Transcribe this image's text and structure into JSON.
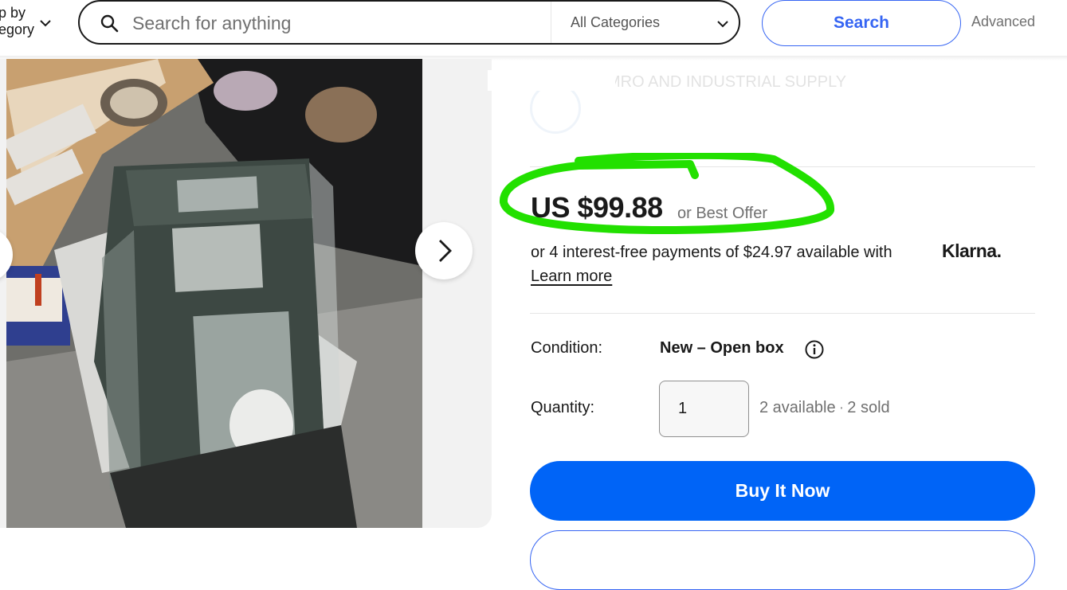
{
  "header": {
    "shop_by_line1": "p by",
    "shop_by_line2": "egory",
    "search_placeholder": "Search for anything",
    "category": "All Categories",
    "search_button": "Search",
    "advanced_link": "Advanced"
  },
  "seller": {
    "name": "MRO AND INDUSTRIAL SUPPLY",
    "line1": "",
    "line2": ""
  },
  "listing": {
    "price": "US $99.88",
    "best_offer": "or Best Offer",
    "installments": "or 4 interest-free payments of $24.97 available with",
    "klarna": "Klarna.",
    "learn_more": "Learn more",
    "condition_label": "Condition:",
    "condition_value": "New – Open box",
    "quantity_label": "Quantity:",
    "quantity_value": "1",
    "available": "2 available",
    "sold": "2 sold",
    "buy_now": "Buy It Now"
  },
  "colors": {
    "accent": "#3665f3",
    "buy_button": "#0064f7",
    "highlight": "#22e000"
  },
  "icons": [
    "chevron-down-icon",
    "search-icon",
    "chevron-right-icon",
    "info-icon"
  ]
}
